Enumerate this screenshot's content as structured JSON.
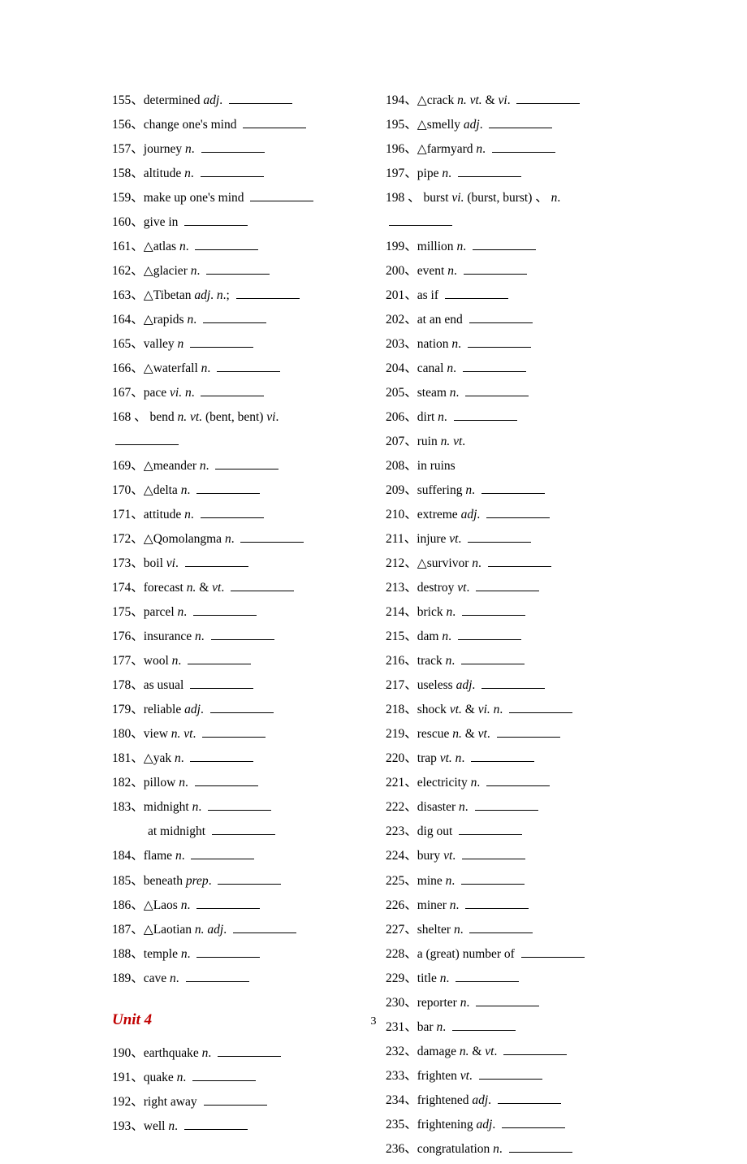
{
  "page_number": "3",
  "unit_heading": "Unit 4",
  "left": [
    {
      "n": "155",
      "w": "determined ",
      "pos": "adj",
      "tail": ". "
    },
    {
      "n": "156",
      "w": "change one's mind ",
      "pos": "",
      "tail": ""
    },
    {
      "n": "157",
      "w": "journey ",
      "pos": "n",
      "tail": ". "
    },
    {
      "n": "158",
      "w": "altitude ",
      "pos": "n",
      "tail": ". "
    },
    {
      "n": "159",
      "w": "make up one's mind ",
      "pos": "",
      "tail": ""
    },
    {
      "n": "160",
      "w": "give in ",
      "pos": "",
      "tail": ""
    },
    {
      "n": "161",
      "w": "△atlas ",
      "pos": "n",
      "tail": ". "
    },
    {
      "n": "162",
      "w": "△glacier ",
      "pos": "n",
      "tail": ". "
    },
    {
      "n": "163",
      "w": "△Tibetan    ",
      "pos": "adj",
      "tail": ".     ",
      "pos2": "n",
      "tail2": ".; "
    },
    {
      "n": "164",
      "w": "△rapids ",
      "pos": "n",
      "tail": ". "
    },
    {
      "n": "165",
      "w": "valley ",
      "pos": "n",
      "tail": " "
    },
    {
      "n": "166",
      "w": "△waterfall ",
      "pos": "n",
      "tail": ". "
    },
    {
      "n": "167",
      "w": "pace ",
      "pos": "vi. n",
      "tail": ". "
    },
    {
      "n": "168",
      "w": "bend ",
      "pos": "n.  vt.",
      "tail": "  (bent,  bent)    ",
      "pos2": "vi",
      "tail2": ".",
      "wrap": true,
      "sep": " 、 "
    },
    {
      "n": "169",
      "w": "△meander ",
      "pos": "n",
      "tail": ". "
    },
    {
      "n": "170",
      "w": "△delta ",
      "pos": "n",
      "tail": ". "
    },
    {
      "n": "171",
      "w": "attitude ",
      "pos": "n",
      "tail": ". "
    },
    {
      "n": "172",
      "w": "△Qomolangma ",
      "pos": "n",
      "tail": ". "
    },
    {
      "n": "173",
      "w": "boil ",
      "pos": "vi",
      "tail": ". "
    },
    {
      "n": "174",
      "w": "forecast ",
      "pos": "n. ",
      "tail": "& ",
      "pos2": "vt",
      "tail2": ". "
    },
    {
      "n": "175",
      "w": "parcel ",
      "pos": "n",
      "tail": ". "
    },
    {
      "n": "176",
      "w": "insurance ",
      "pos": "n",
      "tail": ". "
    },
    {
      "n": "177",
      "w": "wool ",
      "pos": "n",
      "tail": ". "
    },
    {
      "n": "178",
      "w": "as usual ",
      "pos": "",
      "tail": ""
    },
    {
      "n": "179",
      "w": "reliable ",
      "pos": "adj",
      "tail": ". "
    },
    {
      "n": "180",
      "w": "view ",
      "pos": "n.    vt",
      "tail": ". "
    },
    {
      "n": "181",
      "w": "△yak ",
      "pos": "n",
      "tail": ". "
    },
    {
      "n": "182",
      "w": "pillow ",
      "pos": "n",
      "tail": ". "
    },
    {
      "n": "183",
      "w": "midnight ",
      "pos": "n",
      "tail": ". "
    },
    {
      "sub": true,
      "w": "at midnight ",
      "pos": "",
      "tail": ""
    },
    {
      "n": "184",
      "w": "flame ",
      "pos": "n",
      "tail": ". "
    },
    {
      "n": "185",
      "w": "beneath ",
      "pos": "prep",
      "tail": ". "
    },
    {
      "n": "186",
      "w": "△Laos ",
      "pos": "n",
      "tail": ". "
    },
    {
      "n": "187",
      "w": "△Laotian   ",
      "pos": "n.   adj",
      "tail": ". "
    },
    {
      "n": "188",
      "w": "temple ",
      "pos": "n",
      "tail": ". "
    },
    {
      "n": "189",
      "w": "cave ",
      "pos": "n",
      "tail": ". "
    }
  ],
  "left_unit4": [
    {
      "n": "190",
      "w": "earthquake ",
      "pos": "n",
      "tail": ". "
    },
    {
      "n": "191",
      "w": "quake ",
      "pos": "n",
      "tail": ". "
    },
    {
      "n": "192",
      "w": "right away ",
      "pos": "",
      "tail": ""
    },
    {
      "n": "193",
      "w": "well ",
      "pos": "n",
      "tail": ". "
    }
  ],
  "right": [
    {
      "n": "194",
      "w": "△crack ",
      "pos": "n.   vt. ",
      "tail": "& ",
      "pos2": "vi",
      "tail2": ". "
    },
    {
      "n": "195",
      "w": "△smelly ",
      "pos": "adj",
      "tail": ". "
    },
    {
      "n": "196",
      "w": "△farmyard ",
      "pos": "n",
      "tail": ". "
    },
    {
      "n": "197",
      "w": "pipe ",
      "pos": "n",
      "tail": ". "
    },
    {
      "n": "198",
      "w": "burst ",
      "pos": "vi.",
      "tail": "  (burst,  burst)   、     ",
      "pos2": "n",
      "tail2": ".",
      "wrap": true,
      "sep": " 、 "
    },
    {
      "n": "199",
      "w": "million ",
      "pos": "n",
      "tail": ". "
    },
    {
      "n": "200",
      "w": "event ",
      "pos": "n",
      "tail": ". "
    },
    {
      "n": "201",
      "w": "as if ",
      "pos": "",
      "tail": ""
    },
    {
      "n": "202",
      "w": "at an end ",
      "pos": "",
      "tail": ""
    },
    {
      "n": "203",
      "w": "nation ",
      "pos": "n",
      "tail": ". "
    },
    {
      "n": "204",
      "w": "canal ",
      "pos": "n",
      "tail": ". "
    },
    {
      "n": "205",
      "w": "steam ",
      "pos": "n",
      "tail": ". "
    },
    {
      "n": "206",
      "w": "dirt ",
      "pos": "n",
      "tail": ". "
    },
    {
      "n": "207",
      "w": "ruin ",
      "pos": "n.     vt",
      "tail": ".",
      "noblank": true
    },
    {
      "n": "208",
      "w": "in ruins",
      "pos": "",
      "tail": "",
      "noblank": true
    },
    {
      "n": "209",
      "w": "suffering ",
      "pos": "n",
      "tail": ". "
    },
    {
      "n": "210",
      "w": "extreme ",
      "pos": "adj",
      "tail": ". "
    },
    {
      "n": "211",
      "w": "injure   ",
      "pos": "vt",
      "tail": ". "
    },
    {
      "n": "212",
      "w": "△survivor ",
      "pos": "n",
      "tail": ". "
    },
    {
      "n": "213",
      "w": "destroy   ",
      "pos": "vt",
      "tail": ". "
    },
    {
      "n": "214",
      "w": "brick ",
      "pos": "n",
      "tail": ". "
    },
    {
      "n": "215",
      "w": "dam ",
      "pos": "n",
      "tail": ". "
    },
    {
      "n": "216",
      "w": "track ",
      "pos": "n",
      "tail": ". "
    },
    {
      "n": "217",
      "w": "useless ",
      "pos": "adj",
      "tail": ". "
    },
    {
      "n": "218",
      "w": "shock   ",
      "pos": "vt. ",
      "tail": "& ",
      "pos2": "vi.    n",
      "tail2": ". "
    },
    {
      "n": "219",
      "w": "rescue ",
      "pos": "n. ",
      "tail": "& ",
      "pos2": "vt",
      "tail2": ". "
    },
    {
      "n": "220",
      "w": "trap ",
      "pos": "vt. n",
      "tail": ". "
    },
    {
      "n": "221",
      "w": "electricity ",
      "pos": "n",
      "tail": ". "
    },
    {
      "n": "222",
      "w": "disaster ",
      "pos": "n",
      "tail": ". "
    },
    {
      "n": "223",
      "w": "dig out ",
      "pos": "",
      "tail": ""
    },
    {
      "n": "224",
      "w": "bury ",
      "pos": "vt",
      "tail": ". "
    },
    {
      "n": "225",
      "w": "mine ",
      "pos": "n",
      "tail": ". "
    },
    {
      "n": "226",
      "w": "miner ",
      "pos": "n",
      "tail": ". "
    },
    {
      "n": "227",
      "w": "shelter ",
      "pos": "n",
      "tail": ". "
    },
    {
      "n": "228",
      "w": "a (great) number of ",
      "pos": "",
      "tail": ""
    },
    {
      "n": "229",
      "w": "title ",
      "pos": "n",
      "tail": ". "
    },
    {
      "n": "230",
      "w": "reporter ",
      "pos": "n",
      "tail": ". "
    },
    {
      "n": "231",
      "w": "bar ",
      "pos": "n",
      "tail": ". "
    },
    {
      "n": "232",
      "w": "damage ",
      "pos": "n. ",
      "tail": "& ",
      "pos2": "vt",
      "tail2": ". "
    },
    {
      "n": "233",
      "w": "frighten ",
      "pos": "vt",
      "tail": ". "
    },
    {
      "n": "234",
      "w": "frightened ",
      "pos": "adj",
      "tail": ". "
    },
    {
      "n": "235",
      "w": "frightening ",
      "pos": "adj",
      "tail": ". "
    },
    {
      "n": "236",
      "w": "congratulation ",
      "pos": "n",
      "tail": ". "
    }
  ]
}
